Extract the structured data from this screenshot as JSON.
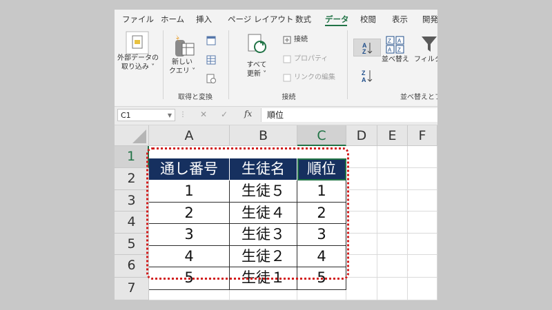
{
  "ribbon": {
    "tabs": [
      "ファイル",
      "ホーム",
      "挿入",
      "ページ レイアウト",
      "数式",
      "データ",
      "校閲",
      "表示",
      "開発"
    ],
    "active_tab": "データ",
    "get_external": [
      "外部データの",
      "取り込み ˅"
    ],
    "new_query": [
      "新しい",
      "クエリ ˅"
    ],
    "group_get_transform": "取得と変換",
    "refresh_all": [
      "すべて",
      "更新 ˅"
    ],
    "connections": "接続",
    "properties": "プロパティ",
    "edit_links": "リンクの編集",
    "group_connections": "接続",
    "sort": "並べ替え",
    "filter": "フィルター",
    "group_sort_filter": "並べ替えとフィ"
  },
  "formula_bar": {
    "name_box": "C1",
    "formula": "順位",
    "cancel_icon": "✕",
    "enter_icon": "✓",
    "fx_label": "fx"
  },
  "sheet": {
    "columns": [
      "A",
      "B",
      "C",
      "D",
      "E",
      "F"
    ],
    "rows": [
      "1",
      "2",
      "3",
      "4",
      "5",
      "6",
      "7"
    ],
    "selected_column": "C",
    "selected_row": "1",
    "headers": [
      "通し番号",
      "生徒名",
      "順位"
    ],
    "data": [
      [
        "1",
        "生徒５",
        "1"
      ],
      [
        "2",
        "生徒４",
        "2"
      ],
      [
        "3",
        "生徒３",
        "3"
      ],
      [
        "4",
        "生徒２",
        "4"
      ],
      [
        "5",
        "生徒１",
        "5"
      ]
    ]
  },
  "colors": {
    "accent": "#217346",
    "header_fill": "#16305f",
    "highlight": "#d11a1a"
  }
}
